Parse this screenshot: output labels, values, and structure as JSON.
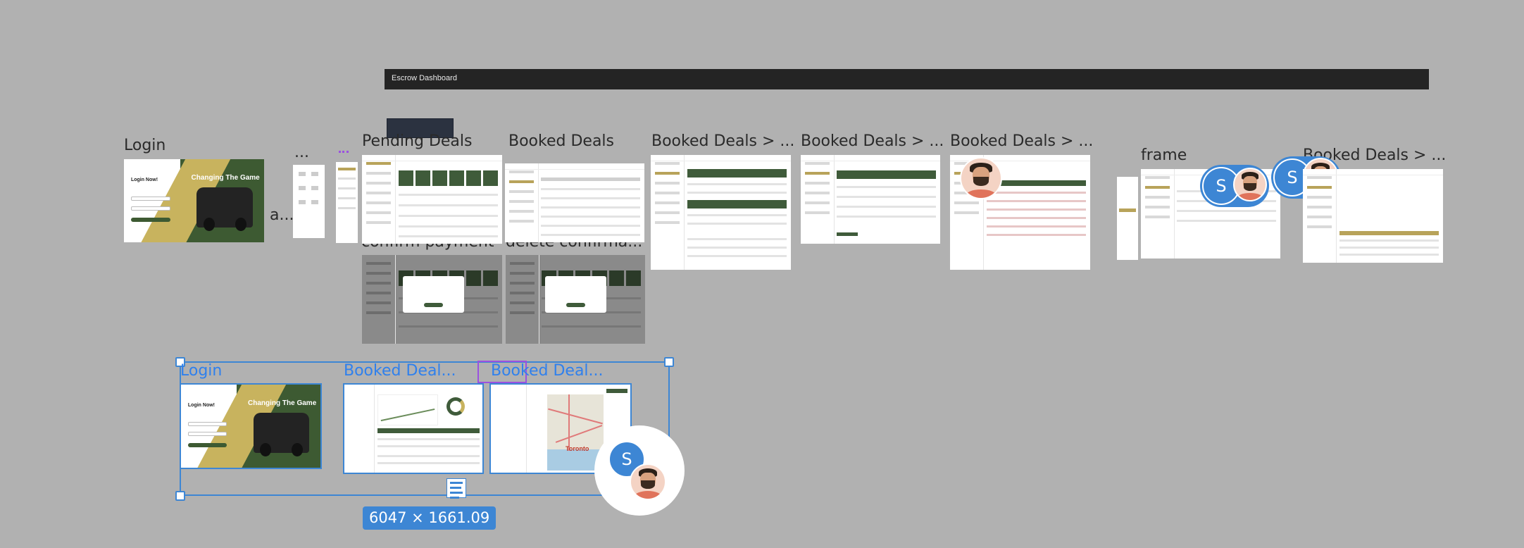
{
  "banner": {
    "title": "Escrow Dashboard"
  },
  "frames": {
    "login_top": "Login",
    "ellipsis_small": "a...",
    "dots_top": "...",
    "pending_deals": "Pending Deals",
    "booked_deals": "Booked Deals",
    "booked_deals_sub1": "Booked Deals > ...",
    "booked_deals_sub2": "Booked Deals > ...",
    "booked_deals_sub3": "Booked Deals > ...",
    "frame": "frame",
    "booked_deals_sub4": "Booked Deals > ...",
    "confirm_payment": "confirm payment",
    "delete_confirm": "delete confirma..."
  },
  "login_thumb": {
    "heading": "Login Now!",
    "headline": "Changing The Game"
  },
  "selection": {
    "login": "Login",
    "booked_a": "Booked Deal...",
    "booked_b": "Booked Deal...",
    "dimensions": "6047 × 1661.09",
    "map_label": "Toronto"
  },
  "avatars": {
    "initial": "S"
  },
  "colors": {
    "canvas": "#b1b1b1",
    "selection": "#3d86d4",
    "accent_green": "#3f5b3a",
    "accent_gold": "#c8b35e",
    "highlight_purple": "#9b51e0"
  }
}
